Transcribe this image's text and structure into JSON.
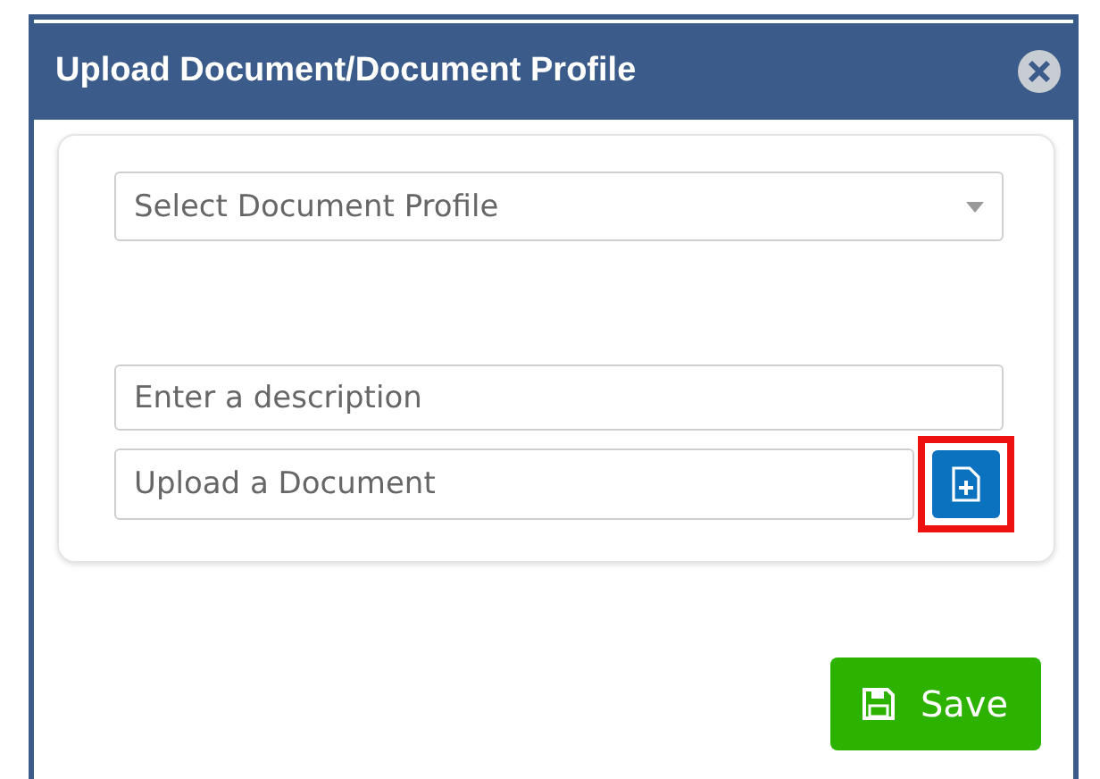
{
  "window": {
    "title": "Upload Document/Document Profile"
  },
  "profile_select": {
    "placeholder": "Select Document Profile"
  },
  "description": {
    "placeholder": "Enter a description"
  },
  "upload": {
    "placeholder": "Upload a Document",
    "highlighted": true
  },
  "buttons": [
    {
      "label": "Save"
    }
  ]
}
